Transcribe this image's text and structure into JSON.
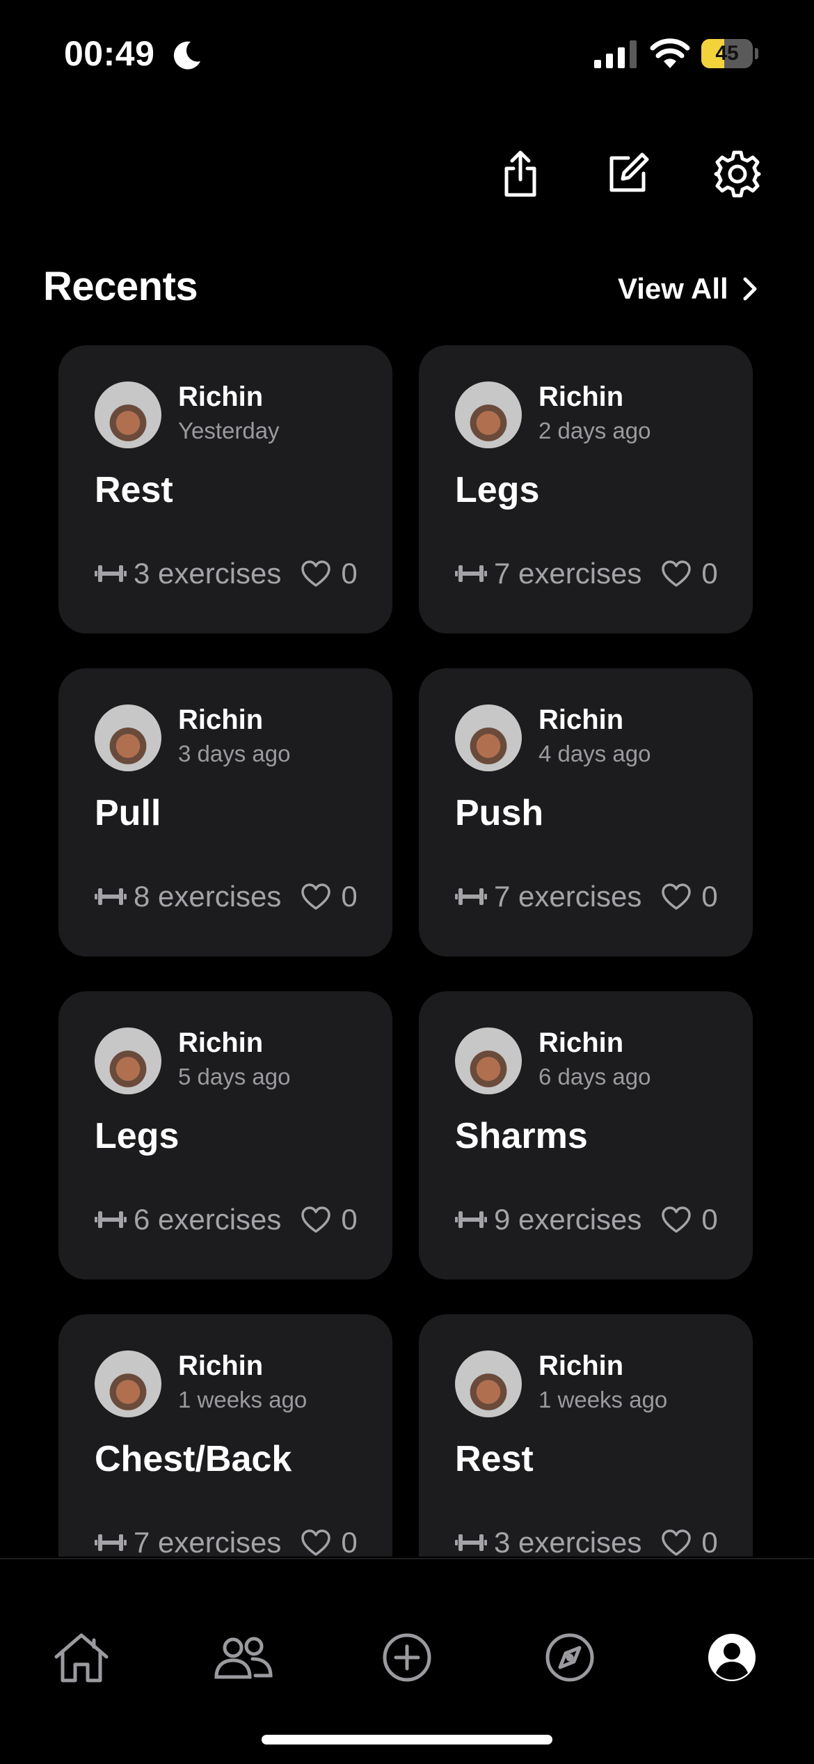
{
  "status_bar": {
    "time": "00:49",
    "battery_level": "45",
    "icons": [
      "moon-icon",
      "signal-icon",
      "wifi-icon",
      "battery-icon"
    ],
    "battery_color": "#f2d33c"
  },
  "toolbar": {
    "icons": [
      "share-icon",
      "edit-icon",
      "settings-icon"
    ]
  },
  "recents": {
    "title": "Recents",
    "view_all_label": "View All",
    "cards": [
      {
        "author": "Richin",
        "time_ago": "Yesterday",
        "title": "Rest",
        "exercises": "3 exercises",
        "likes": "0"
      },
      {
        "author": "Richin",
        "time_ago": "2 days ago",
        "title": "Legs",
        "exercises": "7 exercises",
        "likes": "0"
      },
      {
        "author": "Richin",
        "time_ago": "3 days ago",
        "title": "Pull",
        "exercises": "8 exercises",
        "likes": "0"
      },
      {
        "author": "Richin",
        "time_ago": "4 days ago",
        "title": "Push",
        "exercises": "7 exercises",
        "likes": "0"
      },
      {
        "author": "Richin",
        "time_ago": "5 days ago",
        "title": "Legs",
        "exercises": "6 exercises",
        "likes": "0"
      },
      {
        "author": "Richin",
        "time_ago": "6 days ago",
        "title": "Sharms",
        "exercises": "9 exercises",
        "likes": "0"
      },
      {
        "author": "Richin",
        "time_ago": "1 weeks ago",
        "title": "Chest/Back",
        "exercises": "7 exercises",
        "likes": "0"
      },
      {
        "author": "Richin",
        "time_ago": "1 weeks ago",
        "title": "Rest",
        "exercises": "3 exercises",
        "likes": "0"
      }
    ]
  },
  "tab_bar": {
    "tabs": [
      "home-icon",
      "friends-icon",
      "add-icon",
      "explore-icon",
      "profile-icon"
    ],
    "active": "profile-icon"
  },
  "colors": {
    "background": "#000000",
    "card": "#1c1c1e",
    "secondary_text": "#9a9a9f"
  }
}
